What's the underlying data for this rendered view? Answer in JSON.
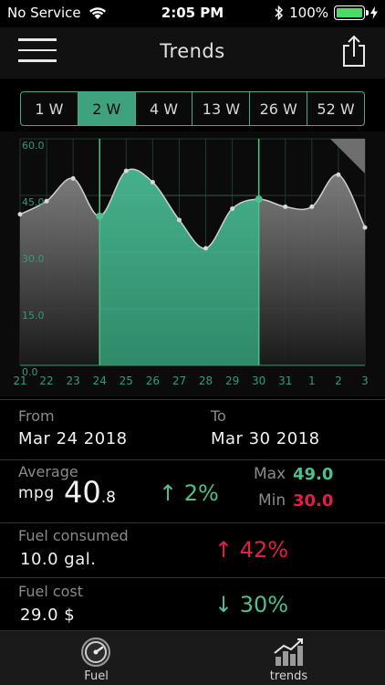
{
  "status": {
    "carrier": "No Service",
    "time": "2:05 PM",
    "battery": "100%"
  },
  "header": {
    "title": "Trends"
  },
  "ranges": [
    {
      "label": "1 W",
      "active": false
    },
    {
      "label": "2 W",
      "active": true
    },
    {
      "label": "4 W",
      "active": false
    },
    {
      "label": "13 W",
      "active": false
    },
    {
      "label": "26 W",
      "active": false
    },
    {
      "label": "52 W",
      "active": false
    }
  ],
  "chart_data": {
    "type": "area",
    "y_ticks": [
      "60.0",
      "45.0",
      "30.0",
      "15.0",
      "0.0"
    ],
    "ylim": [
      0,
      60
    ],
    "x": [
      "21",
      "22",
      "23",
      "24",
      "25",
      "26",
      "27",
      "28",
      "29",
      "30",
      "31",
      "1",
      "2",
      "3"
    ],
    "values": [
      40.0,
      43.5,
      49.5,
      39.5,
      51.5,
      48.5,
      38.5,
      31.0,
      41.5,
      44.0,
      42.0,
      42.0,
      50.5,
      36.5
    ],
    "highlight_range": [
      "24",
      "30"
    ],
    "colors": {
      "highlight_fill": "#3a9e7c",
      "line": "#cfcfcf",
      "grid": "#1f3a30",
      "axis_text": "#2f9c76"
    }
  },
  "period": {
    "from_label": "From",
    "from_value": "Mar 24 2018",
    "to_label": "To",
    "to_value": "Mar 30 2018"
  },
  "average": {
    "label": "Average",
    "unit": "mpg",
    "value_int": "40",
    "value_dec": ".8",
    "change": "↑ 2%",
    "max_label": "Max",
    "max_value": "49.0",
    "min_label": "Min",
    "min_value": "30.0"
  },
  "fuel": {
    "label": "Fuel consumed",
    "value": "10.0 gal.",
    "change": "↑ 42%"
  },
  "cost": {
    "label": "Fuel cost",
    "value": "29.0 $",
    "change": "↓ 30%"
  },
  "tabs": {
    "fuel_label": "Fuel",
    "trends_label": "trends"
  },
  "icons": {
    "wifi": "wifi-icon",
    "bluetooth": "bluetooth-icon",
    "charging": "charging-icon",
    "menu": "menu-icon",
    "share": "share-icon",
    "fuel": "fuel-gauge-icon",
    "trends": "trends-chart-icon"
  }
}
